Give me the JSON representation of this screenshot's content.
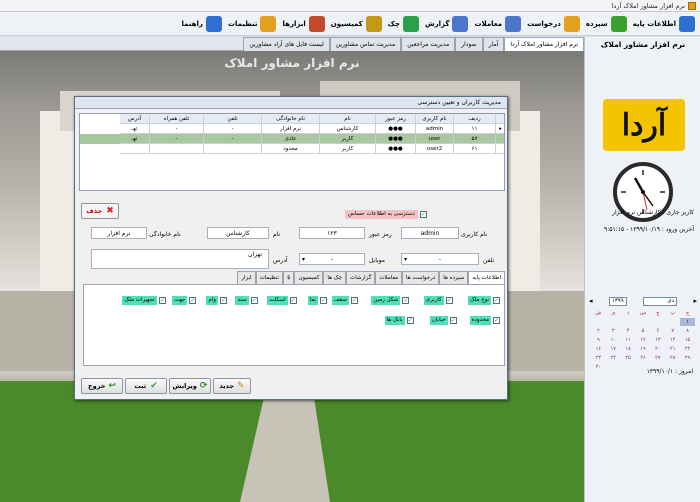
{
  "window": {
    "title": "نرم افزار مشاور املاک آردا"
  },
  "toolbar": {
    "items": [
      {
        "label": "اطلاعات پایه",
        "icon": "gear-folder-icon",
        "color": "#2e6fd1"
      },
      {
        "label": "سپرده",
        "icon": "folder-plus-icon",
        "color": "#3aa12c"
      },
      {
        "label": "درخواست",
        "icon": "folder-icon",
        "color": "#e0a020"
      },
      {
        "label": "معاملات",
        "icon": "document-pen-icon",
        "color": "#4a77c9"
      },
      {
        "label": "گزارش",
        "icon": "search-icon",
        "color": "#4a77c9"
      },
      {
        "label": "چک",
        "icon": "check-icon",
        "color": "#2aa04a"
      },
      {
        "label": "کمیسیون",
        "icon": "coins-icon",
        "color": "#c29a1a"
      },
      {
        "label": "ابزارها",
        "icon": "tools-icon",
        "color": "#c04a2a"
      },
      {
        "label": "تنظیمات",
        "icon": "settings-gear-icon",
        "color": "#e0a020"
      },
      {
        "label": "راهنما",
        "icon": "help-icon",
        "color": "#2e6fd1"
      }
    ]
  },
  "tabs": [
    {
      "label": "نرم افزار مشاور املاک آردا",
      "active": true
    },
    {
      "label": "آمار",
      "active": false
    },
    {
      "label": "نمودار",
      "active": false
    },
    {
      "label": "مدیریت مراجعین",
      "active": false
    },
    {
      "label": "مدیریت تماس مشاورین",
      "active": false
    },
    {
      "label": "لیست فایل های آزاد مشاورین",
      "active": false
    }
  ],
  "watermark": "نرم افزار مشاور املاک",
  "right_panel": {
    "title": "نرم افزار مشاور املاک",
    "logo_text": "آردا",
    "current_user": "کاربر جاری : کارشناس نرم افزار",
    "last_login": "آخرین ورود : ۱۳۹۹/۱۰/۱۹ - ۹:۵۱:۱۵",
    "calendar": {
      "month": "دی",
      "year": "۱۳۹۹",
      "weekdays": [
        "ش",
        "ی",
        "د",
        "س",
        "چ",
        "پ",
        "ج"
      ],
      "days": [
        "",
        "",
        "",
        "",
        "",
        "",
        "۱",
        "۲",
        "۳",
        "۴",
        "۵",
        "۶",
        "۷",
        "۸",
        "۹",
        "۱۰",
        "۱۱",
        "۱۲",
        "۱۳",
        "۱۴",
        "۱۵",
        "۱۶",
        "۱۷",
        "۱۸",
        "۱۹",
        "۲۰",
        "۲۱",
        "۲۲",
        "۲۳",
        "۲۴",
        "۲۵",
        "۲۶",
        "۲۷",
        "۲۸",
        "۲۹",
        "۳۰"
      ],
      "selected_day": "۱",
      "today": "امروز : ۱۳۹۹/۱۰/۱"
    }
  },
  "dialog": {
    "title": "مدیریت کاربران و تعیین دسترسی",
    "grid": {
      "headers": [
        "ردیف",
        "نام کاربری",
        "رمز عبور",
        "نام",
        "نام خانوادگی",
        "تلفن",
        "تلفن همراه",
        "آدرس"
      ],
      "rows": [
        [
          "۱۱",
          "admin",
          "●●●",
          "کارشناس",
          "نرم افزار",
          "-",
          "-",
          "تهـ"
        ],
        [
          "۵۷",
          "user",
          "●●●",
          "کاربر",
          "عادی",
          "-",
          "-",
          "تهـ"
        ],
        [
          "۶۱",
          "user2",
          "●●●",
          "کاربر",
          "محدود",
          "",
          "",
          ""
        ]
      ]
    },
    "delete_label": "حذف",
    "sensitive_access_label": "دسترسی به اطلاعات حساس",
    "form": {
      "username_label": "نام کاربری",
      "username_value": "admin",
      "password_label": "رمز عبور",
      "password_value": "۱۲۳",
      "name_label": "نام",
      "name_value": "کارشناس",
      "family_label": "نام خانوادگی",
      "family_value": "نرم افزار",
      "phone_label": "تلفن",
      "phone_value": "-",
      "mobile_label": "موبایل",
      "mobile_value": "-",
      "address_label": "آدرس",
      "address_value": "تهران"
    },
    "perm_tabs": [
      {
        "label": "اطلاعات پایه",
        "active": true
      },
      {
        "label": "سپرده ها",
        "active": false
      },
      {
        "label": "درخواست ها",
        "active": false
      },
      {
        "label": "معاملات",
        "active": false
      },
      {
        "label": "گزارشات",
        "active": false
      },
      {
        "label": "چک ها",
        "active": false
      },
      {
        "label": "کمیسیون",
        "active": false
      },
      {
        "label": "$",
        "active": false
      },
      {
        "label": "تنظیمات",
        "active": false
      },
      {
        "label": "ابزار",
        "active": false
      }
    ],
    "perms_row1": [
      "نوع ملک",
      "کاربری",
      "شکل زمین",
      "سقف",
      "نما",
      "اسکلت",
      "سند",
      "وام",
      "جهت",
      "تجهیزات ملک"
    ],
    "perms_row2": [
      "محدوده",
      "خیابان",
      "بانک ها"
    ],
    "buttons": {
      "new": "جدید",
      "edit": "ویرایش",
      "save": "ثبت",
      "exit": "خروج"
    }
  }
}
